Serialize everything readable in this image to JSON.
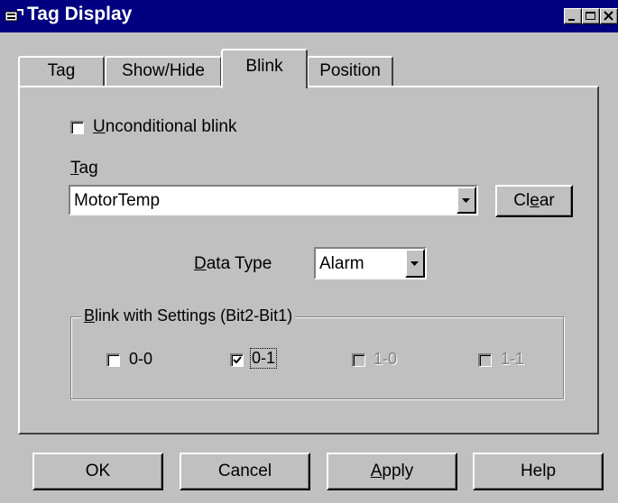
{
  "window": {
    "title": "Tag Display",
    "minimize_icon": "minimize-icon",
    "maximize_icon": "maximize-icon",
    "close_icon": "close-icon"
  },
  "tabs": [
    {
      "label": "Tag",
      "active": false
    },
    {
      "label": "Show/Hide",
      "active": false
    },
    {
      "label": "Blink",
      "active": true
    },
    {
      "label": "Position",
      "active": false
    }
  ],
  "blink": {
    "unconditional_pre": "",
    "unconditional_ul": "U",
    "unconditional_post": "nconditional blink",
    "unconditional_checked": false,
    "tag_label_ul": "T",
    "tag_label_post": "ag",
    "tag_value": "MotorTemp",
    "clear_pre": "Cl",
    "clear_ul": "e",
    "clear_post": "ar",
    "datatype_label_ul": "D",
    "datatype_label_post": "ata Type",
    "datatype_value": "Alarm",
    "group_label_ul": "B",
    "group_label_post": "link with Settings (Bit2-Bit1)",
    "options": [
      {
        "label": "0-0",
        "checked": false,
        "enabled": true
      },
      {
        "label": "0-1",
        "checked": true,
        "enabled": true
      },
      {
        "label": "1-0",
        "checked": false,
        "enabled": false
      },
      {
        "label": "1-1",
        "checked": false,
        "enabled": false
      }
    ]
  },
  "buttons": {
    "ok": "OK",
    "cancel": "Cancel",
    "apply_ul": "A",
    "apply_post": "pply",
    "help": "Help"
  }
}
